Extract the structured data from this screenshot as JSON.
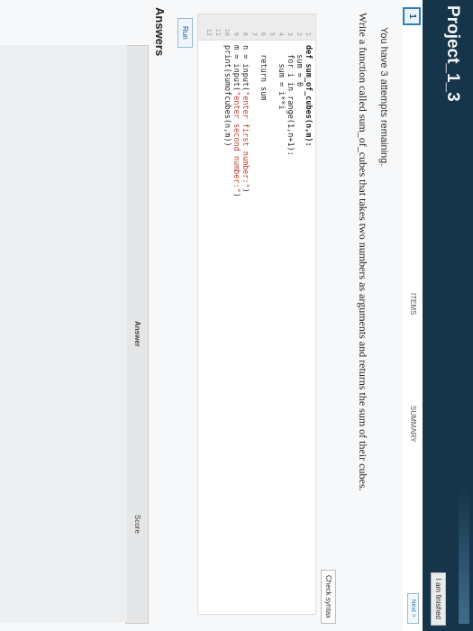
{
  "header": {
    "project_title": "Project_1_3",
    "finish_label": "I am finished"
  },
  "nav": {
    "item_number": "1",
    "items_label": "ITEMS",
    "summary_label": "SUMMARY",
    "next_label": "Next >"
  },
  "question": {
    "attempts": "You have 3 attempts remaining.",
    "prompt": "Write a function called sum_of_cubes that takes two numbers as arguments and returns the sum of their cubes."
  },
  "editor": {
    "check_syntax_label": "Check syntax",
    "line_numbers": [
      "1",
      "2",
      "3",
      "4",
      "5",
      "6",
      "7",
      "8",
      "9",
      "10",
      "11",
      "12"
    ],
    "lines": {
      "l1": "def sum_of_cubes(n,m):",
      "l2": "  sum = 0",
      "l3": "  for i in range(1,n+1):",
      "l4": "    sum = i**i",
      "l6": "  return sum",
      "l8a": "n = input(",
      "l8s": "\"enter first number:\"",
      "l8b": ")",
      "l9a": "m = input(",
      "l9s": "\"enter second number:\"",
      "l9b": ")",
      "l10": "print(sumofcubes(n,m))"
    }
  },
  "run_label": "Run",
  "answers": {
    "heading": "Answers",
    "answer_col": "Answer",
    "score_col": "Score"
  }
}
